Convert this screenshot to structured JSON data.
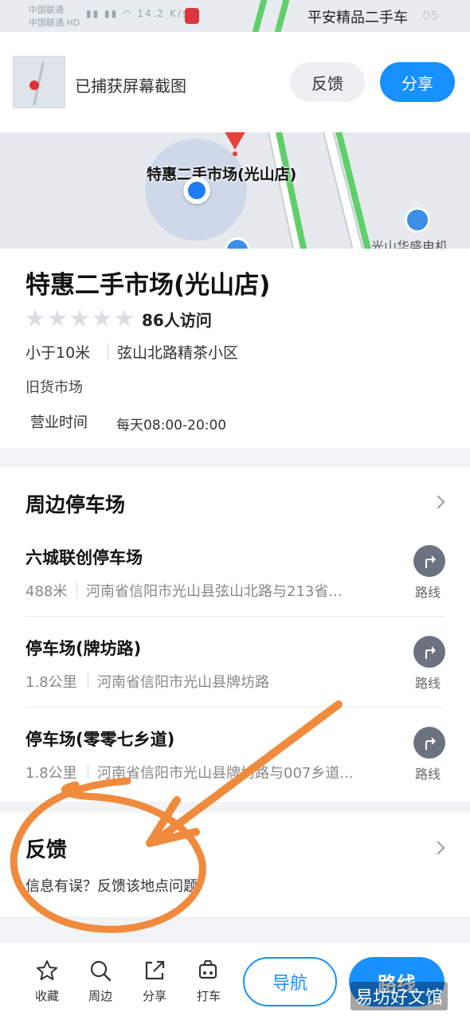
{
  "status": {
    "carrier1": "中国联通",
    "carrier2": "中国联通",
    "hd": "HD",
    "net_speed": "14.2",
    "net_unit": "K/s",
    "title": "平安精品二手车",
    "time": "05"
  },
  "capture": {
    "text": "已捕获屏幕截图",
    "feedback_label": "反馈",
    "share_label": "分享"
  },
  "map": {
    "poi_label": "特惠二手市场(光山店)",
    "nearby_label": "光山华盛电机"
  },
  "poi": {
    "title": "特惠二手市场(光山店)",
    "visits": "86人访问",
    "distance": "小于10米",
    "address": "弦山北路精茶小区",
    "category": "旧货市场",
    "hours_label": "营业时间",
    "hours_value": "每天08:00-20:00"
  },
  "parking": {
    "title": "周边停车场",
    "route_label": "路线",
    "items": [
      {
        "name": "六城联创停车场",
        "distance": "488米",
        "address": "河南省信阳市光山县弦山北路与213省..."
      },
      {
        "name": "停车场(牌坊路)",
        "distance": "1.8公里",
        "address": "河南省信阳市光山县牌坊路"
      },
      {
        "name": "停车场(零零七乡道)",
        "distance": "1.8公里",
        "address": "河南省信阳市光山县牌坊路与007乡道..."
      }
    ]
  },
  "feedback": {
    "title": "反馈",
    "subtitle": "信息有误？反馈该地点问题"
  },
  "bottom": {
    "tabs": [
      {
        "label": "收藏",
        "icon": "star-icon"
      },
      {
        "label": "周边",
        "icon": "search-icon"
      },
      {
        "label": "分享",
        "icon": "share-icon"
      },
      {
        "label": "打车",
        "icon": "taxi-icon"
      }
    ],
    "nav_label": "导航",
    "route_label": "路线"
  },
  "watermark": "易坊好文馆",
  "colors": {
    "accent": "#1890ff",
    "annotation": "#f08a3c"
  }
}
